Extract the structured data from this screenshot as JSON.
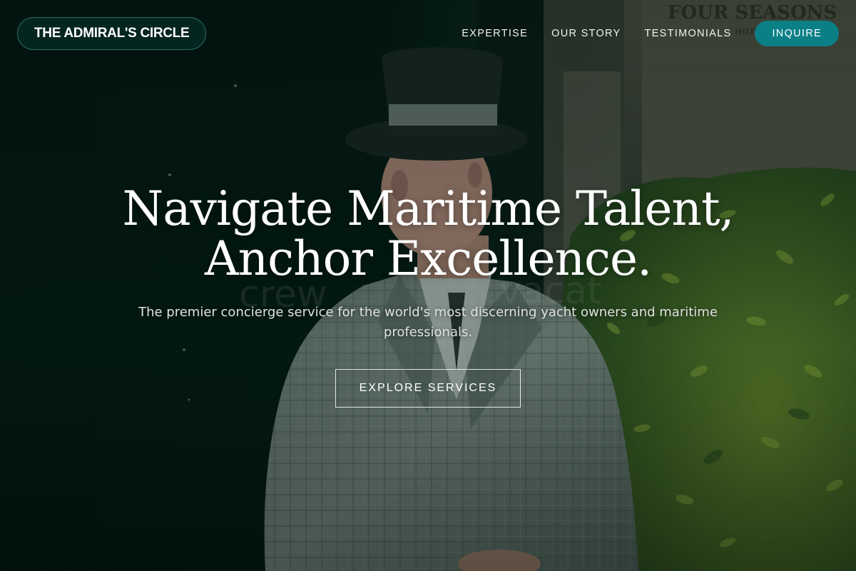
{
  "brand": {
    "name": "THE ADMIRAL'S CIRCLE"
  },
  "nav": {
    "links": [
      "EXPERTISE",
      "OUR STORY",
      "TESTIMONIALS"
    ],
    "cta": "INQUIRE"
  },
  "hero": {
    "title_line1": "Navigate Maritime Talent,",
    "title_line2": "Anchor Excellence.",
    "subtitle": "The premier concierge service for the world's most discerning yacht owners and maritime professionals.",
    "cta": "EXPLORE SERVICES",
    "background": {
      "description_icon": "doorman-photo",
      "sign_text": "FOUR SEASONS",
      "sign_subtext": "HOTEL"
    }
  },
  "colors": {
    "accent": "#0b7f86",
    "background": "#04130f",
    "logo_border": "#2a6b63"
  }
}
